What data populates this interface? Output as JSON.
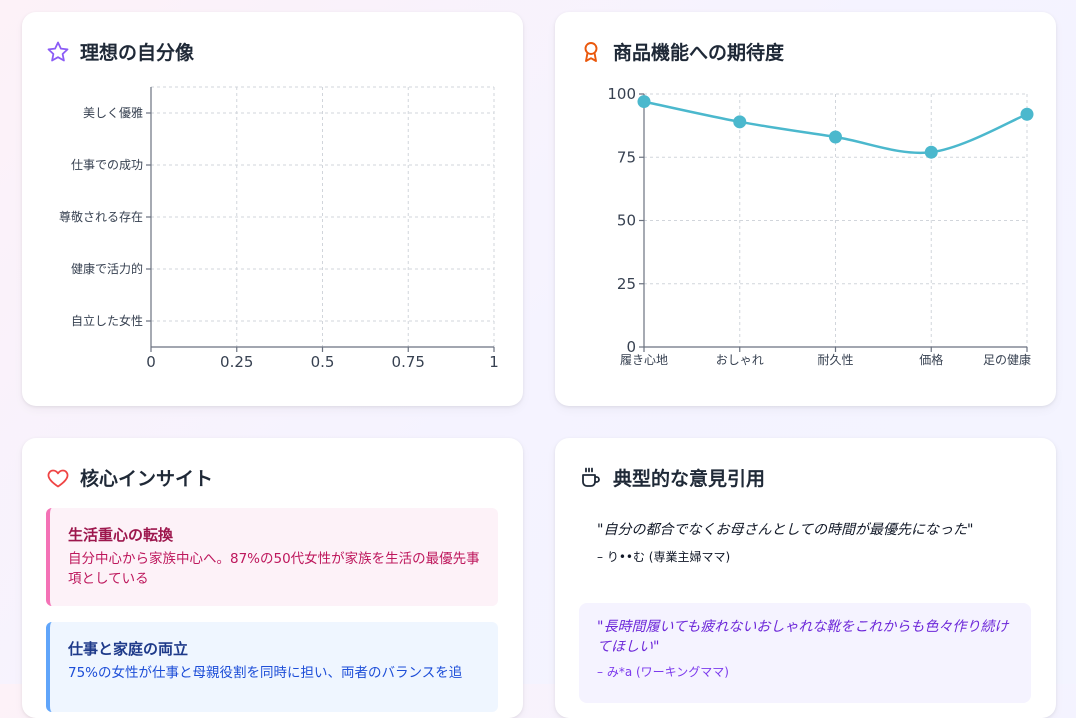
{
  "cards": {
    "ideal_self": {
      "title": "理想の自分像",
      "icon": "star-icon"
    },
    "expectations": {
      "title": "商品機能への期待度",
      "icon": "award-icon"
    },
    "insights": {
      "title": "核心インサイト",
      "icon": "heart-icon"
    },
    "quotes": {
      "title": "典型的な意見引用",
      "icon": "coffee-cup-icon"
    }
  },
  "insights": [
    {
      "title": "生活重心の転換",
      "text": "自分中心から家族中心へ。87%の50代女性が家族を生活の最優先事項としている"
    },
    {
      "title": "仕事と家庭の両立",
      "text": "75%の女性が仕事と母親役割を同時に担い、両者のバランスを追"
    }
  ],
  "quotes": [
    {
      "text": "\"自分の都合でなくお母さんとしての時間が最優先になった\"",
      "author": "– り••む (専業主婦ママ)"
    },
    {
      "text": "\"長時間履いても疲れないおしゃれな靴をこれからも色々作り続けてほしい\"",
      "author": "– み*a (ワーキングママ)"
    }
  ],
  "colors": {
    "line": "#4bb8cd",
    "insight1_bg": "#fdf2f8",
    "insight1_border": "#f472b6",
    "insight1_title": "#9d174d",
    "insight1_text": "#be185d",
    "insight2_bg": "#eff6ff",
    "insight2_border": "#60a5fa",
    "insight2_title": "#1e3a8a",
    "insight2_text": "#1d4ed8",
    "quote2_bg": "#f5f3ff",
    "quote2_text": "#6d28d9"
  },
  "chart_data": [
    {
      "type": "bar",
      "orientation": "horizontal",
      "categories": [
        "美しく優雅",
        "仕事での成功",
        "尊敬される存在",
        "健康で活力的",
        "自立した女性"
      ],
      "values": [],
      "xlim": [
        0,
        1
      ],
      "xticks": [
        "0",
        "0.25",
        "0.5",
        "0.75",
        "1"
      ],
      "grid": true
    },
    {
      "type": "line",
      "categories": [
        "履き心地",
        "おしゃれ",
        "耐久性",
        "価格",
        "足の健康"
      ],
      "values": [
        97,
        89,
        83,
        77,
        92
      ],
      "ylim": [
        0,
        100
      ],
      "yticks": [
        "0",
        "25",
        "50",
        "75",
        "100"
      ],
      "grid": true
    }
  ]
}
